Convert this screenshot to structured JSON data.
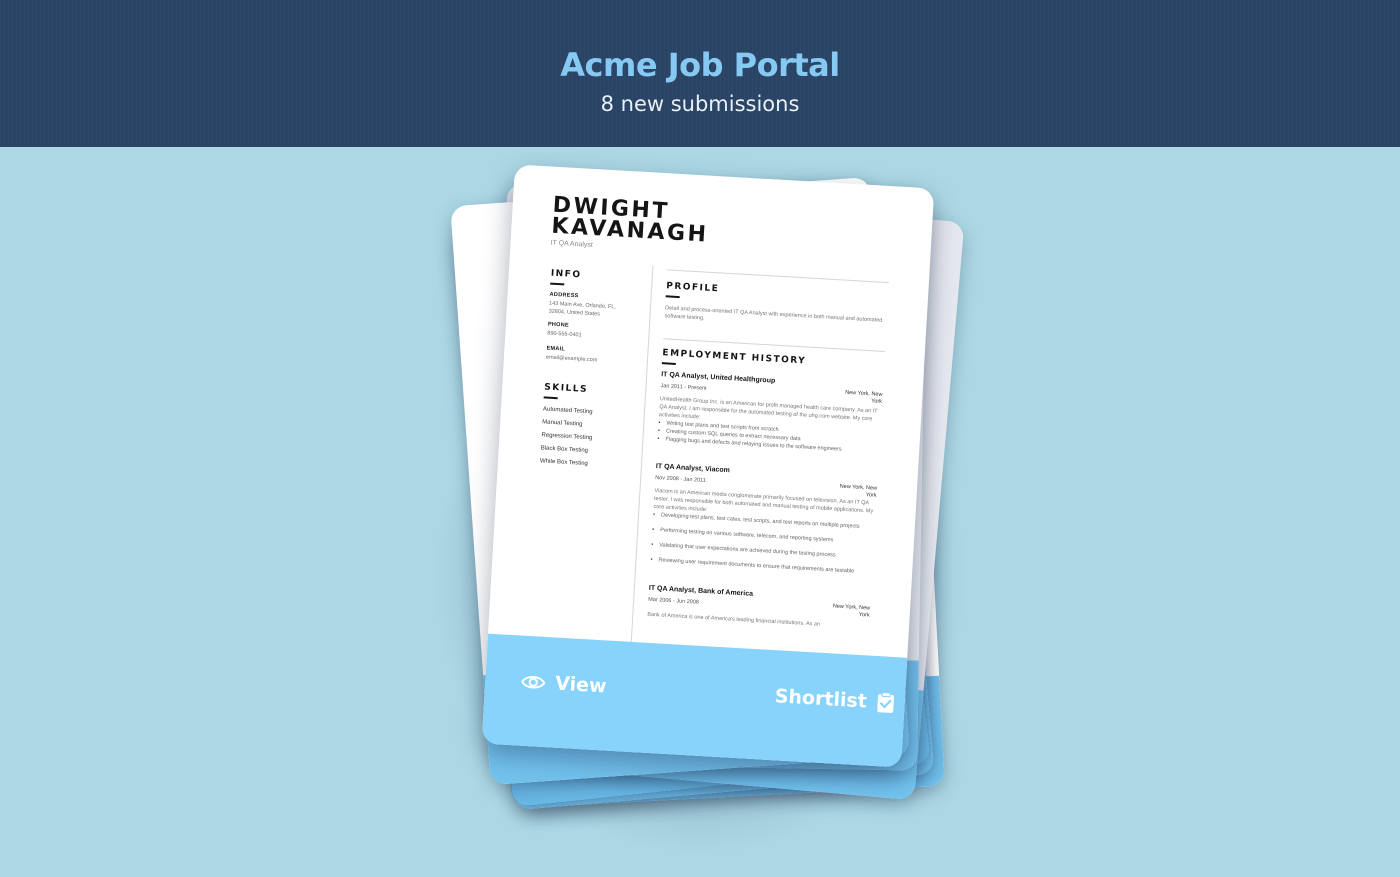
{
  "header": {
    "title": "Acme Job Portal",
    "subtitle": "8 new submissions"
  },
  "colors": {
    "header_bg": "#2a4466",
    "title": "#86c9f3",
    "page_bg": "#acd8e5",
    "card_band": "#87d3fb"
  },
  "resume": {
    "name_line1": "DWIGHT",
    "name_line2": "KAVANAGH",
    "role": "IT QA Analyst",
    "info": {
      "heading": "INFO",
      "address_label": "ADDRESS",
      "address_line1": "143 Main Ave, Orlando, FL,",
      "address_line2": "32804, United States",
      "phone_label": "PHONE",
      "phone": "890-555-0401",
      "email_label": "EMAIL",
      "email": "email@example.com"
    },
    "skills": {
      "heading": "SKILLS",
      "items": [
        "Automated Testing",
        "Manual Testing",
        "Regression Testing",
        "Black Box Testing",
        "White Box Testing"
      ]
    },
    "profile": {
      "heading": "PROFILE",
      "text": "Detail and process-oriented IT QA Analyst with experience in both manual and automated software testing."
    },
    "employment": {
      "heading": "EMPLOYMENT HISTORY",
      "jobs": [
        {
          "title": "IT QA Analyst, United Healthgroup",
          "dates": "Jan 2011 - Present",
          "location": "New York, New York",
          "description": "UnitedHealth Group Inc. is an American for profit managed health care company. As an IT QA Analyst, I am responsible for the automated testing of the uhg.com website. My core activities include:",
          "bullets": [
            "Writing test plans and test scripts from scratch",
            "Creating custom SQL queries to extract necessary data",
            "Flagging bugs and defects and relaying issues to the software engineers"
          ]
        },
        {
          "title": "IT QA Analyst, Viacom",
          "dates": "Nov 2008 - Jan 2011",
          "location": "New York, New York",
          "description": "Viacom is an American media conglomerate primarily focused on television. As an IT QA tester, I was responsible for both automated and manual testing of mobile applications. My core activities include:",
          "bullets": [
            "Developing test plans, test cates, test scripts, and test reports on multiple projects",
            "Performing testing on various software, telecom, and reporting systems",
            "Validating that user expectations are achieved during the testing process",
            "Reviewing user requirement documents to ensure that requirements are testable"
          ]
        },
        {
          "title": "IT QA Analyst, Bank of America",
          "dates": "Mar 2006 - Jun 2008",
          "location": "New York, New York",
          "description": "Bank of America is one of America's leading financial institutions. As an"
        }
      ]
    }
  },
  "actions": {
    "view_label": "View",
    "shortlist_label": "Shortlist"
  },
  "icons": {
    "view": "eye-icon",
    "shortlist": "clipboard-check-icon"
  }
}
